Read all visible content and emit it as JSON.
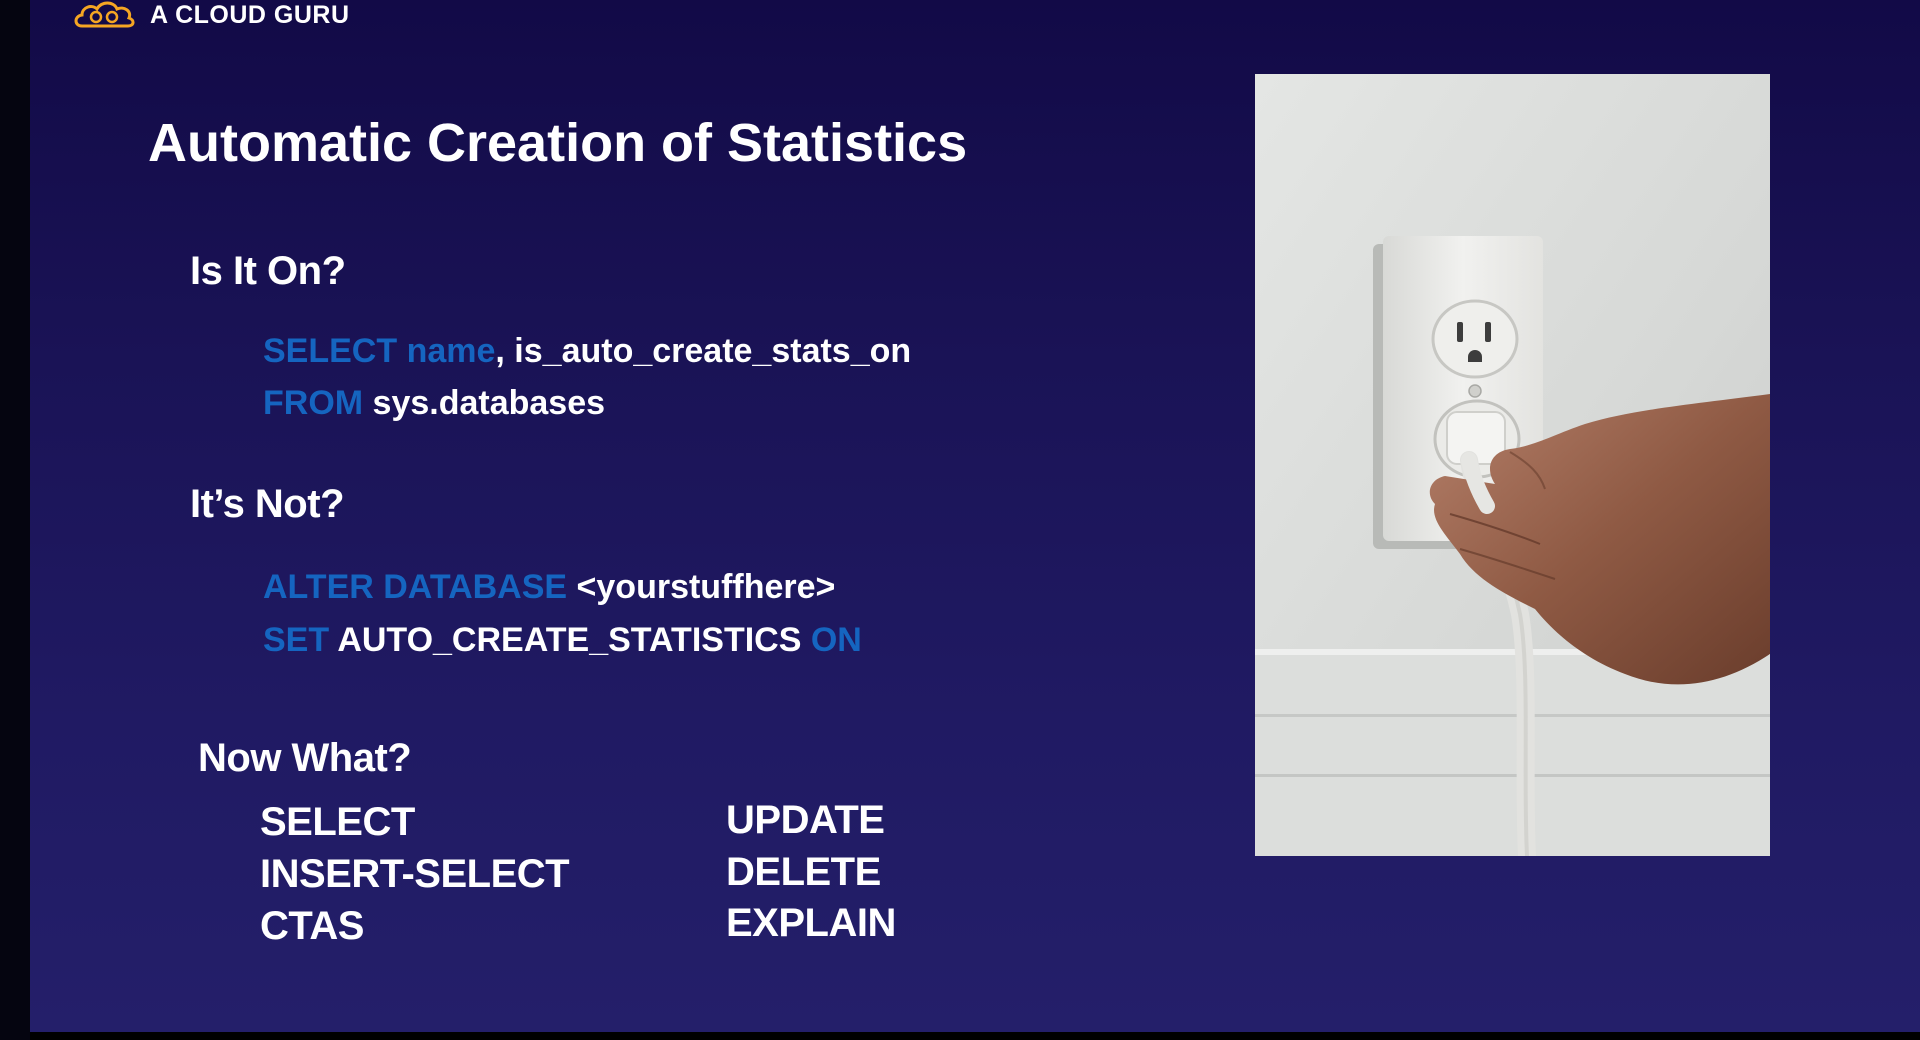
{
  "brand": {
    "name": "A CLOUD GURU"
  },
  "slide": {
    "title": "Automatic Creation of Statistics",
    "section1": {
      "heading": "Is It On?",
      "line1": {
        "kw1": "SELECT",
        "kw2": "name",
        "rest": ", is_auto_create_stats_on"
      },
      "line2": {
        "kw": "FROM",
        "rest": "sys.databases"
      }
    },
    "section2": {
      "heading": "It’s Not?",
      "line1": {
        "kw": "ALTER DATABASE",
        "rest": "<yourstuffhere>"
      },
      "line2": {
        "kw1": "SET",
        "mid": "AUTO_CREATE_STATISTICS",
        "kw2": "ON"
      }
    },
    "section3": {
      "heading": "Now What?",
      "left_items": [
        "SELECT",
        "INSERT-SELECT",
        "CTAS"
      ],
      "right_items": [
        "UPDATE",
        "DELETE",
        "EXPLAIN"
      ]
    }
  },
  "colors": {
    "keyword": "#1565c0",
    "text": "#ffffff",
    "background": "#1a1356",
    "brand_accent": "#f5a623"
  }
}
